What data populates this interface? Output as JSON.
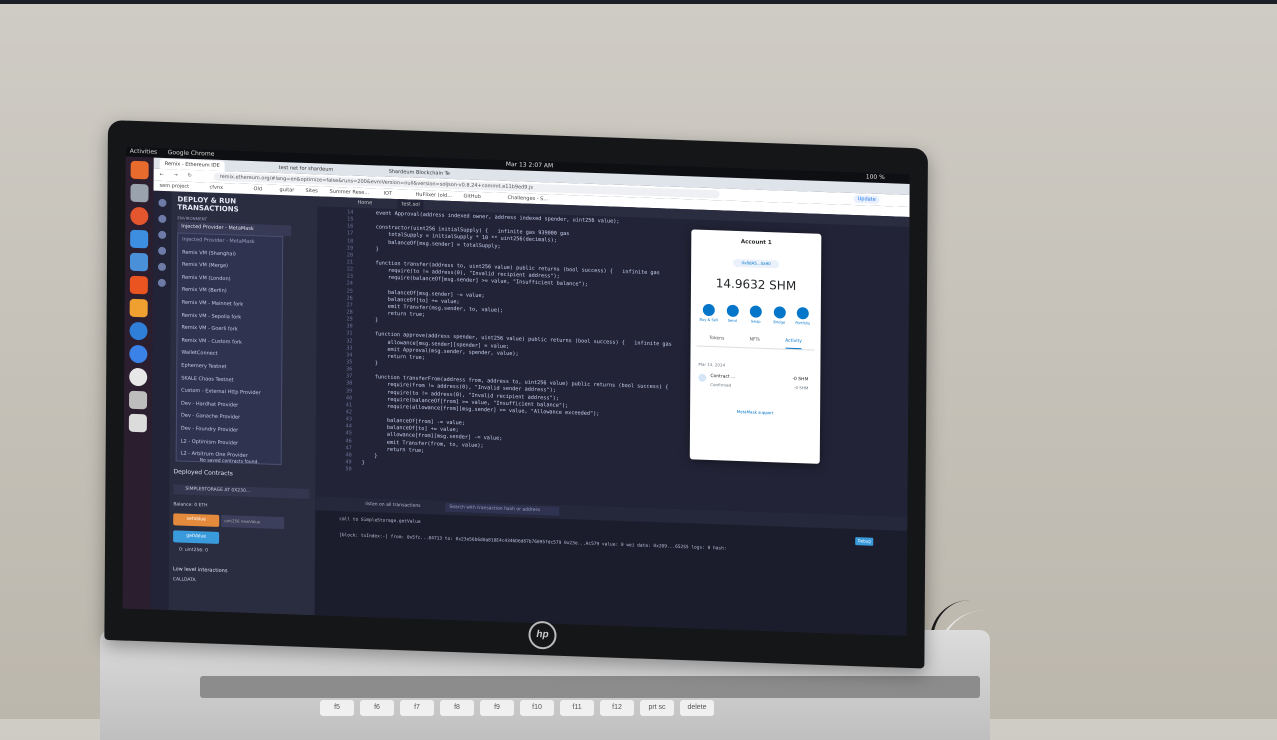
{
  "os": {
    "activities": "Activities",
    "app": "Google Chrome",
    "clock": "Mar 13  2:07 AM",
    "battery": "100 %"
  },
  "browser": {
    "tabs": [
      {
        "label": "Remix - Ethereum IDE"
      },
      {
        "label": "test net for shardeum"
      },
      {
        "label": "Shardeum Blockchain Te"
      }
    ],
    "url": "remix.ethereum.org/#lang=en&optimize=false&runs=200&evmVersion=null&version=soljson-v0.8.24+commit.e11b9ed9.js",
    "bookmarks": [
      "sem project",
      "cfvnx",
      "Old",
      "guitar",
      "Sites",
      "Summer Rese...",
      "IOT",
      "HuFlixer (old...",
      "GitHub",
      "Challenges - S..."
    ],
    "update": "Update"
  },
  "remix": {
    "panel_title": "DEPLOY & RUN TRANSACTIONS",
    "environment_label": "ENVIRONMENT",
    "environment_value": "Injected Provider - MetaMask",
    "environment_options": [
      "Injected Provider - MetaMask",
      "Remix VM (Shanghai)",
      "Remix VM (Merge)",
      "Remix VM (London)",
      "Remix VM (Berlin)",
      "Remix VM - Mainnet fork",
      "Remix VM - Sepolia fork",
      "Remix VM - Goerli fork",
      "Remix VM - Custom fork",
      "WalletConnect",
      "Ephemery Testnet",
      "SKALE Chaos Testnet",
      "Custom - External Http Provider",
      "Dev - Hardhat Provider",
      "Dev - Ganache Provider",
      "Dev - Foundry Provider",
      "L2 - Optimism Provider",
      "L2 - Arbitrum One Provider"
    ],
    "no_contracts": "No saved contracts found.",
    "deployed_title": "Deployed Contracts",
    "instance": "SIMPLESTORAGE AT 0X230...",
    "balance": "Balance: 0 ETH",
    "set_button": "setValue",
    "set_placeholder": "uint256 newValue",
    "get_button": "getValue",
    "get_result": "0: uint256: 0",
    "low_level": "Low level interactions",
    "calldata": "CALLDATA",
    "editor_tabs": [
      "Home",
      "test.sol"
    ],
    "code": [
      {
        "n": "14",
        "t": "    event Approval(address indexed owner, address indexed spender, uint256 value);"
      },
      {
        "n": "15",
        "t": ""
      },
      {
        "n": "16",
        "t": "    constructor(uint256 initialSupply) {   infinite gas 939000 gas"
      },
      {
        "n": "17",
        "t": "        totalSupply = initialSupply * 10 ** uint256(decimals);"
      },
      {
        "n": "18",
        "t": "        balanceOf[msg.sender] = totalSupply;"
      },
      {
        "n": "19",
        "t": "    }"
      },
      {
        "n": "20",
        "t": ""
      },
      {
        "n": "21",
        "t": "    function transfer(address to, uint256 value) public returns (bool success) {   infinite gas"
      },
      {
        "n": "22",
        "t": "        require(to != address(0), \"Invalid recipient address\");"
      },
      {
        "n": "23",
        "t": "        require(balanceOf[msg.sender] >= value, \"Insufficient balance\");"
      },
      {
        "n": "24",
        "t": ""
      },
      {
        "n": "25",
        "t": "        balanceOf[msg.sender] -= value;"
      },
      {
        "n": "26",
        "t": "        balanceOf[to] += value;"
      },
      {
        "n": "27",
        "t": "        emit Transfer(msg.sender, to, value);"
      },
      {
        "n": "28",
        "t": "        return true;"
      },
      {
        "n": "29",
        "t": "    }"
      },
      {
        "n": "30",
        "t": ""
      },
      {
        "n": "31",
        "t": "    function approve(address spender, uint256 value) public returns (bool success) {   infinite gas"
      },
      {
        "n": "32",
        "t": "        allowance[msg.sender][spender] = value;"
      },
      {
        "n": "33",
        "t": "        emit Approval(msg.sender, spender, value);"
      },
      {
        "n": "34",
        "t": "        return true;"
      },
      {
        "n": "35",
        "t": "    }"
      },
      {
        "n": "36",
        "t": ""
      },
      {
        "n": "37",
        "t": "    function transferFrom(address from, address to, uint256 value) public returns (bool success) {"
      },
      {
        "n": "38",
        "t": "        require(from != address(0), \"Invalid sender address\");"
      },
      {
        "n": "39",
        "t": "        require(to != address(0), \"Invalid recipient address\");"
      },
      {
        "n": "40",
        "t": "        require(balanceOf[from] >= value, \"Insufficient balance\");"
      },
      {
        "n": "41",
        "t": "        require(allowance[from][msg.sender] >= value, \"Allowance exceeded\");"
      },
      {
        "n": "42",
        "t": ""
      },
      {
        "n": "43",
        "t": "        balanceOf[from] -= value;"
      },
      {
        "n": "44",
        "t": "        balanceOf[to] += value;"
      },
      {
        "n": "45",
        "t": "        allowance[from][msg.sender] -= value;"
      },
      {
        "n": "46",
        "t": "        emit Transfer(from, to, value);"
      },
      {
        "n": "47",
        "t": "        return true;"
      },
      {
        "n": "48",
        "t": "    }"
      },
      {
        "n": "49",
        "t": "}"
      },
      {
        "n": "50",
        "t": ""
      }
    ],
    "listen_label": "listen on all transactions",
    "search_placeholder": "Search with transaction hash or address",
    "call_line": "call to SimpleStorage.getValue",
    "debug_button": "Debug",
    "tx_line": "[block: txIndex:-] from: 0x5fc...84713 to: 0x23e56b6d0a818E4c4346D6d87b76095fdc579 0x23e...Ac579 value: 0 wei data: 0x209...65255 logs: 0 hash:"
  },
  "metamask": {
    "account": "Account 1",
    "address": "0x8dA5...0a90",
    "balance": "14.9632 SHM",
    "actions": [
      "Buy & Sell",
      "Send",
      "Swap",
      "Bridge",
      "Portfolio"
    ],
    "tabs": [
      "Tokens",
      "NFTs",
      "Activity"
    ],
    "date": "Mar 13, 2024",
    "tx_title": "Contract ...",
    "tx_status": "Confirmed",
    "tx_amount": "-0 SHM",
    "tx_amount2": "-0 SHM",
    "support": "MetaMask support"
  },
  "laptop": {
    "brand": "hp",
    "keys": [
      "f5",
      "f6",
      "f7",
      "f8",
      "f9",
      "f10",
      "f11",
      "f12",
      "prt sc",
      "delete"
    ]
  },
  "colors": {
    "remix_bg": "#222336",
    "metamask_blue": "#0376c9",
    "deploy_orange": "#e48a3c"
  }
}
